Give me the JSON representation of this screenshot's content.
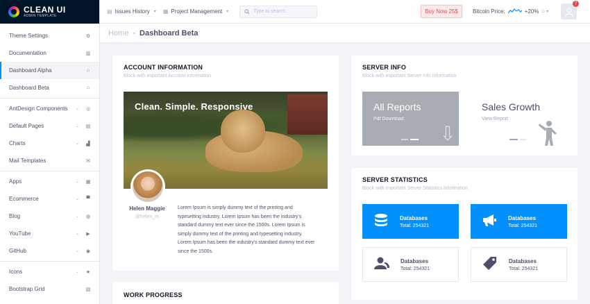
{
  "logo": {
    "title": "CLEAN UI",
    "subtitle": "ADMIN TEMPLATE"
  },
  "sidebar": {
    "items": [
      {
        "label": "Theme Settings",
        "icon": "gear-icon",
        "symbol": "⚙"
      },
      {
        "label": "Documentation",
        "icon": "books-icon",
        "symbol": "▥"
      },
      {
        "label": "Dashboard Alpha",
        "icon": "home-icon",
        "symbol": "⌂",
        "active": true
      },
      {
        "label": "Dashboard Beta",
        "icon": "home-icon",
        "symbol": "⌂"
      },
      {
        "label": "AntDesign Components",
        "icon": "compass-icon",
        "symbol": "◎",
        "chevron": true
      },
      {
        "label": "Default Pages",
        "icon": "page-icon",
        "symbol": "▤",
        "chevron": true
      },
      {
        "label": "Charts",
        "icon": "chart-icon",
        "symbol": "▟",
        "chevron": true
      },
      {
        "label": "Mail Templates",
        "icon": "mail-icon",
        "symbol": "✉"
      },
      {
        "label": "Apps",
        "icon": "database-icon",
        "symbol": "▦",
        "chevron": true
      },
      {
        "label": "Ecommerce",
        "icon": "cart-icon",
        "symbol": "▀",
        "chevron": true
      },
      {
        "label": "Blog",
        "icon": "dribbble-icon",
        "symbol": "◍",
        "chevron": true
      },
      {
        "label": "YouTube",
        "icon": "youtube-icon",
        "symbol": "▶",
        "chevron": true
      },
      {
        "label": "GitHub",
        "icon": "github-icon",
        "symbol": "◉",
        "chevron": true
      },
      {
        "label": "Icons",
        "icon": "star-icon",
        "symbol": "★",
        "chevron": true
      },
      {
        "label": "Bootstrap Grid",
        "icon": "grid-icon",
        "symbol": "▧"
      }
    ]
  },
  "topbar": {
    "issues_label": "Issues History",
    "project_label": "Project Management",
    "search_placeholder": "Type to search...",
    "buy_label": "Buy Now 25$",
    "btc_label": "Bitcoin Price:",
    "btc_change": "+20%",
    "notification_count": "7"
  },
  "breadcrumb": {
    "home": "Home",
    "separator": "·",
    "current": "Dashboard Beta"
  },
  "account": {
    "title": "ACCOUNT INFORMATION",
    "subtitle": "Block with important Account information",
    "hero_title": "Clean. Simple. Responsive",
    "name": "Helen Maggie",
    "handle": "@helen_m",
    "text": "Lorem Ipsum is simply dummy text of the printing and typesetting industry. Lorem Ipsum has been the industry's standard dummy text ever since the 1500s. Lorem Ipsum is simply dummy text of the printing and typesetting industry. Lorem Ipsum has been the industry's standard dummy text ever since the 1500s."
  },
  "work": {
    "title": "WORK PROGRESS"
  },
  "server_info": {
    "title": "SERVER INFO",
    "subtitle": "Block with important Server Info information",
    "tile1_title": "All Reports",
    "tile1_sub": "Pdf Download",
    "tile2_title": "Sales Growth",
    "tile2_sub": "View Report"
  },
  "server_stats": {
    "title": "SERVER STATISTICS",
    "subtitle": "Block with important Server Statistics information",
    "cards": [
      {
        "label": "Databases",
        "value": "Total: 254321",
        "icon": "database-icon",
        "symbol": "☰",
        "style": "blue"
      },
      {
        "label": "Databases",
        "value": "Total: 254321",
        "icon": "megaphone-icon",
        "symbol": "📢",
        "style": "blue"
      },
      {
        "label": "Databases",
        "value": "Total: 254321",
        "icon": "users-icon",
        "symbol": "👥",
        "style": "outline"
      },
      {
        "label": "Databases",
        "value": "Total: 254321",
        "icon": "tag-icon",
        "symbol": "🏷",
        "style": "outline"
      }
    ]
  },
  "colors": {
    "accent": "#0190fe",
    "sidebar_logo_bg": "#001529",
    "danger": "#e4474f",
    "page_bg": "#f2f4f8"
  }
}
